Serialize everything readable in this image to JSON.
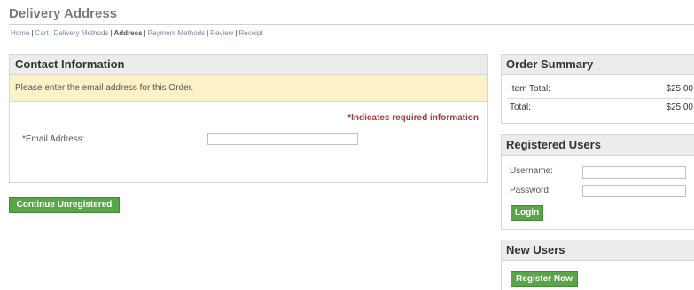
{
  "page": {
    "title": "Delivery Address"
  },
  "breadcrumb": {
    "items": [
      {
        "label": "Home",
        "current": false
      },
      {
        "label": "Cart",
        "current": false
      },
      {
        "label": "Delivery Methods",
        "current": false
      },
      {
        "label": "Address",
        "current": true
      },
      {
        "label": "Payment Methods",
        "current": false
      },
      {
        "label": "Review",
        "current": false
      },
      {
        "label": "Receipt",
        "current": false
      }
    ],
    "separator": "|"
  },
  "contact": {
    "header": "Contact Information",
    "notice": "Please enter the email address for this Order.",
    "required_note": "*Indicates required information",
    "email_label": "*Email Address:",
    "email_value": ""
  },
  "buttons": {
    "continue_unregistered": "Continue Unregistered",
    "login": "Login",
    "register_now": "Register Now"
  },
  "order_summary": {
    "header": "Order Summary",
    "item_total_label": "Item Total:",
    "item_total_value": "$25.00",
    "total_label": "Total:",
    "total_value": "$25.00"
  },
  "registered_users": {
    "header": "Registered Users",
    "username_label": "Username:",
    "username_value": "",
    "password_label": "Password:",
    "password_value": ""
  },
  "new_users": {
    "header": "New Users"
  },
  "colors": {
    "accent_green": "#5aa44a",
    "notice_bg": "#fdf1c7",
    "required_red": "#a33b3b"
  }
}
